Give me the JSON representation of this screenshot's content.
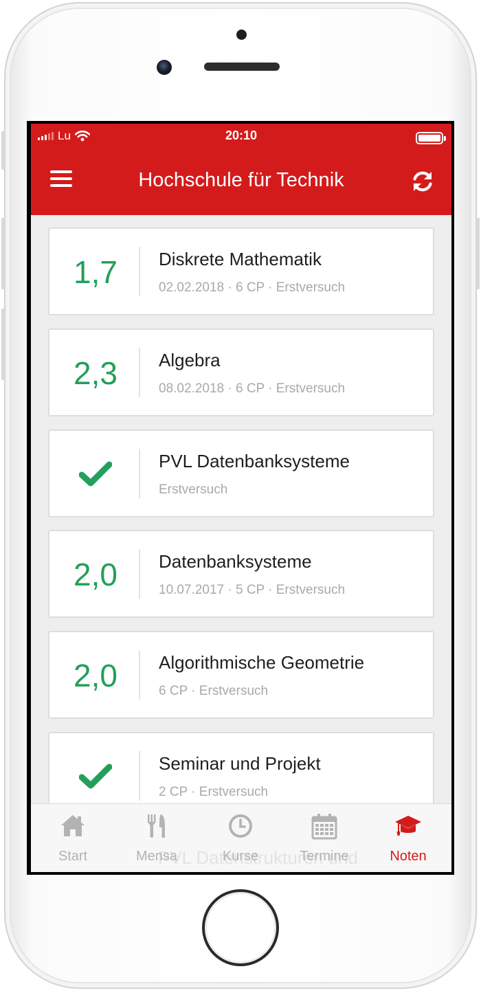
{
  "status_bar": {
    "carrier": "Lu",
    "time": "20:10"
  },
  "app_bar": {
    "title": "Hochschule für Technik"
  },
  "grades": [
    {
      "grade": "1,7",
      "passed_icon": false,
      "title": "Diskrete Mathematik",
      "meta": "02.02.2018 · 6 CP · Erstversuch"
    },
    {
      "grade": "2,3",
      "passed_icon": false,
      "title": "Algebra",
      "meta": "08.02.2018 · 6 CP · Erstversuch"
    },
    {
      "grade": "",
      "passed_icon": true,
      "title": "PVL Datenbanksysteme",
      "meta": "Erstversuch"
    },
    {
      "grade": "2,0",
      "passed_icon": false,
      "title": "Datenbanksysteme",
      "meta": "10.07.2017 · 5 CP · Erstversuch"
    },
    {
      "grade": "2,0",
      "passed_icon": false,
      "title": "Algorithmische Geometrie",
      "meta": "6 CP · Erstversuch"
    },
    {
      "grade": "",
      "passed_icon": true,
      "title": "Seminar und Projekt",
      "meta": "2 CP · Erstversuch"
    }
  ],
  "partially_hidden_item": "PVL Datenstrukturen und",
  "tabs": [
    {
      "label": "Start",
      "icon": "home-icon",
      "active": false
    },
    {
      "label": "Mensa",
      "icon": "cutlery-icon",
      "active": false
    },
    {
      "label": "Kurse",
      "icon": "clock-icon",
      "active": false
    },
    {
      "label": "Termine",
      "icon": "calendar-icon",
      "active": false
    },
    {
      "label": "Noten",
      "icon": "graduation-cap-icon",
      "active": true
    }
  ],
  "colors": {
    "brand_red": "#d41b1b",
    "grade_green": "#22a05a",
    "inactive_tab": "#b3b3b3"
  }
}
